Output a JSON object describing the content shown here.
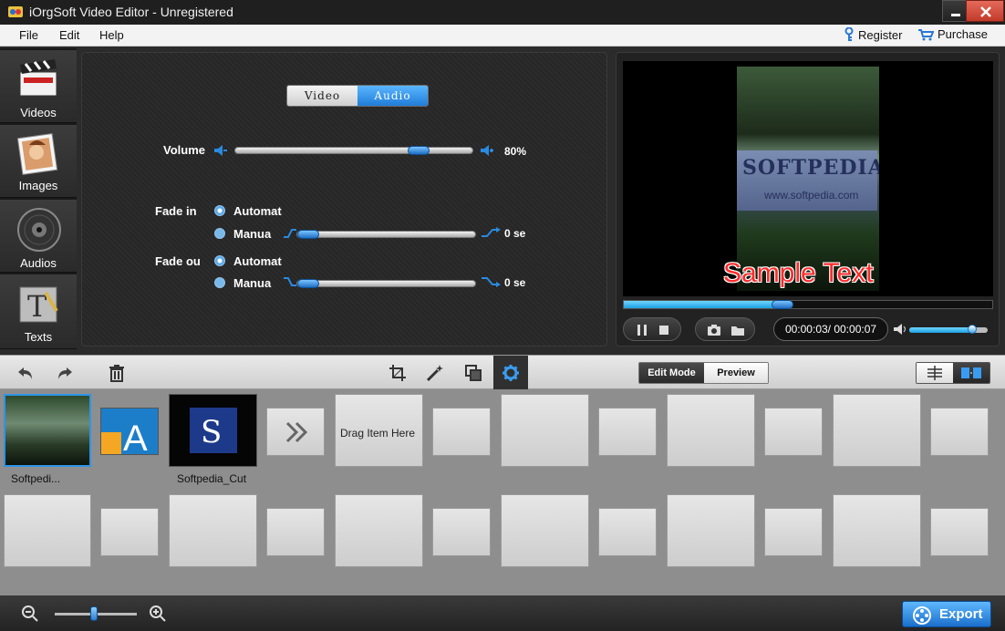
{
  "window": {
    "title": "iOrgSoft Video Editor - Unregistered"
  },
  "menu": {
    "file": "File",
    "edit": "Edit",
    "help": "Help",
    "register": "Register",
    "purchase": "Purchase"
  },
  "sidebar": {
    "items": [
      {
        "label": "Videos"
      },
      {
        "label": "Images"
      },
      {
        "label": "Audios"
      },
      {
        "label": "Texts"
      }
    ]
  },
  "settings": {
    "tabs": {
      "video": "Video",
      "audio": "Audio",
      "active": "Audio"
    },
    "volume": {
      "label": "Volume",
      "value_text": "80%",
      "value": 0.8
    },
    "fade_in": {
      "label": "Fade in",
      "auto": "Automat",
      "manual": "Manua",
      "value_text": "0 se"
    },
    "fade_out": {
      "label": "Fade ou",
      "auto": "Automat",
      "manual": "Manua",
      "value_text": "0 se"
    }
  },
  "preview": {
    "overlay_text": "Sample Text",
    "sign_text": "SOFTPEDIA",
    "sign_url": "www.softpedia.com",
    "time": "00:00:03/ 00:00:07",
    "progress": 0.43,
    "volume": 0.8
  },
  "toolbar": {
    "edit_mode": "Edit Mode",
    "preview": "Preview"
  },
  "timeline": {
    "clips": [
      {
        "label": "Softpedi..."
      },
      {
        "label": ""
      },
      {
        "label": "Softpedia_Cut"
      }
    ],
    "drag_hint": "Drag Item Here"
  },
  "bottom": {
    "export_label": "Export",
    "zoom": 0.5
  },
  "colors": {
    "accent": "#1f7dd8",
    "overlay_text": "#ff2a2a"
  }
}
